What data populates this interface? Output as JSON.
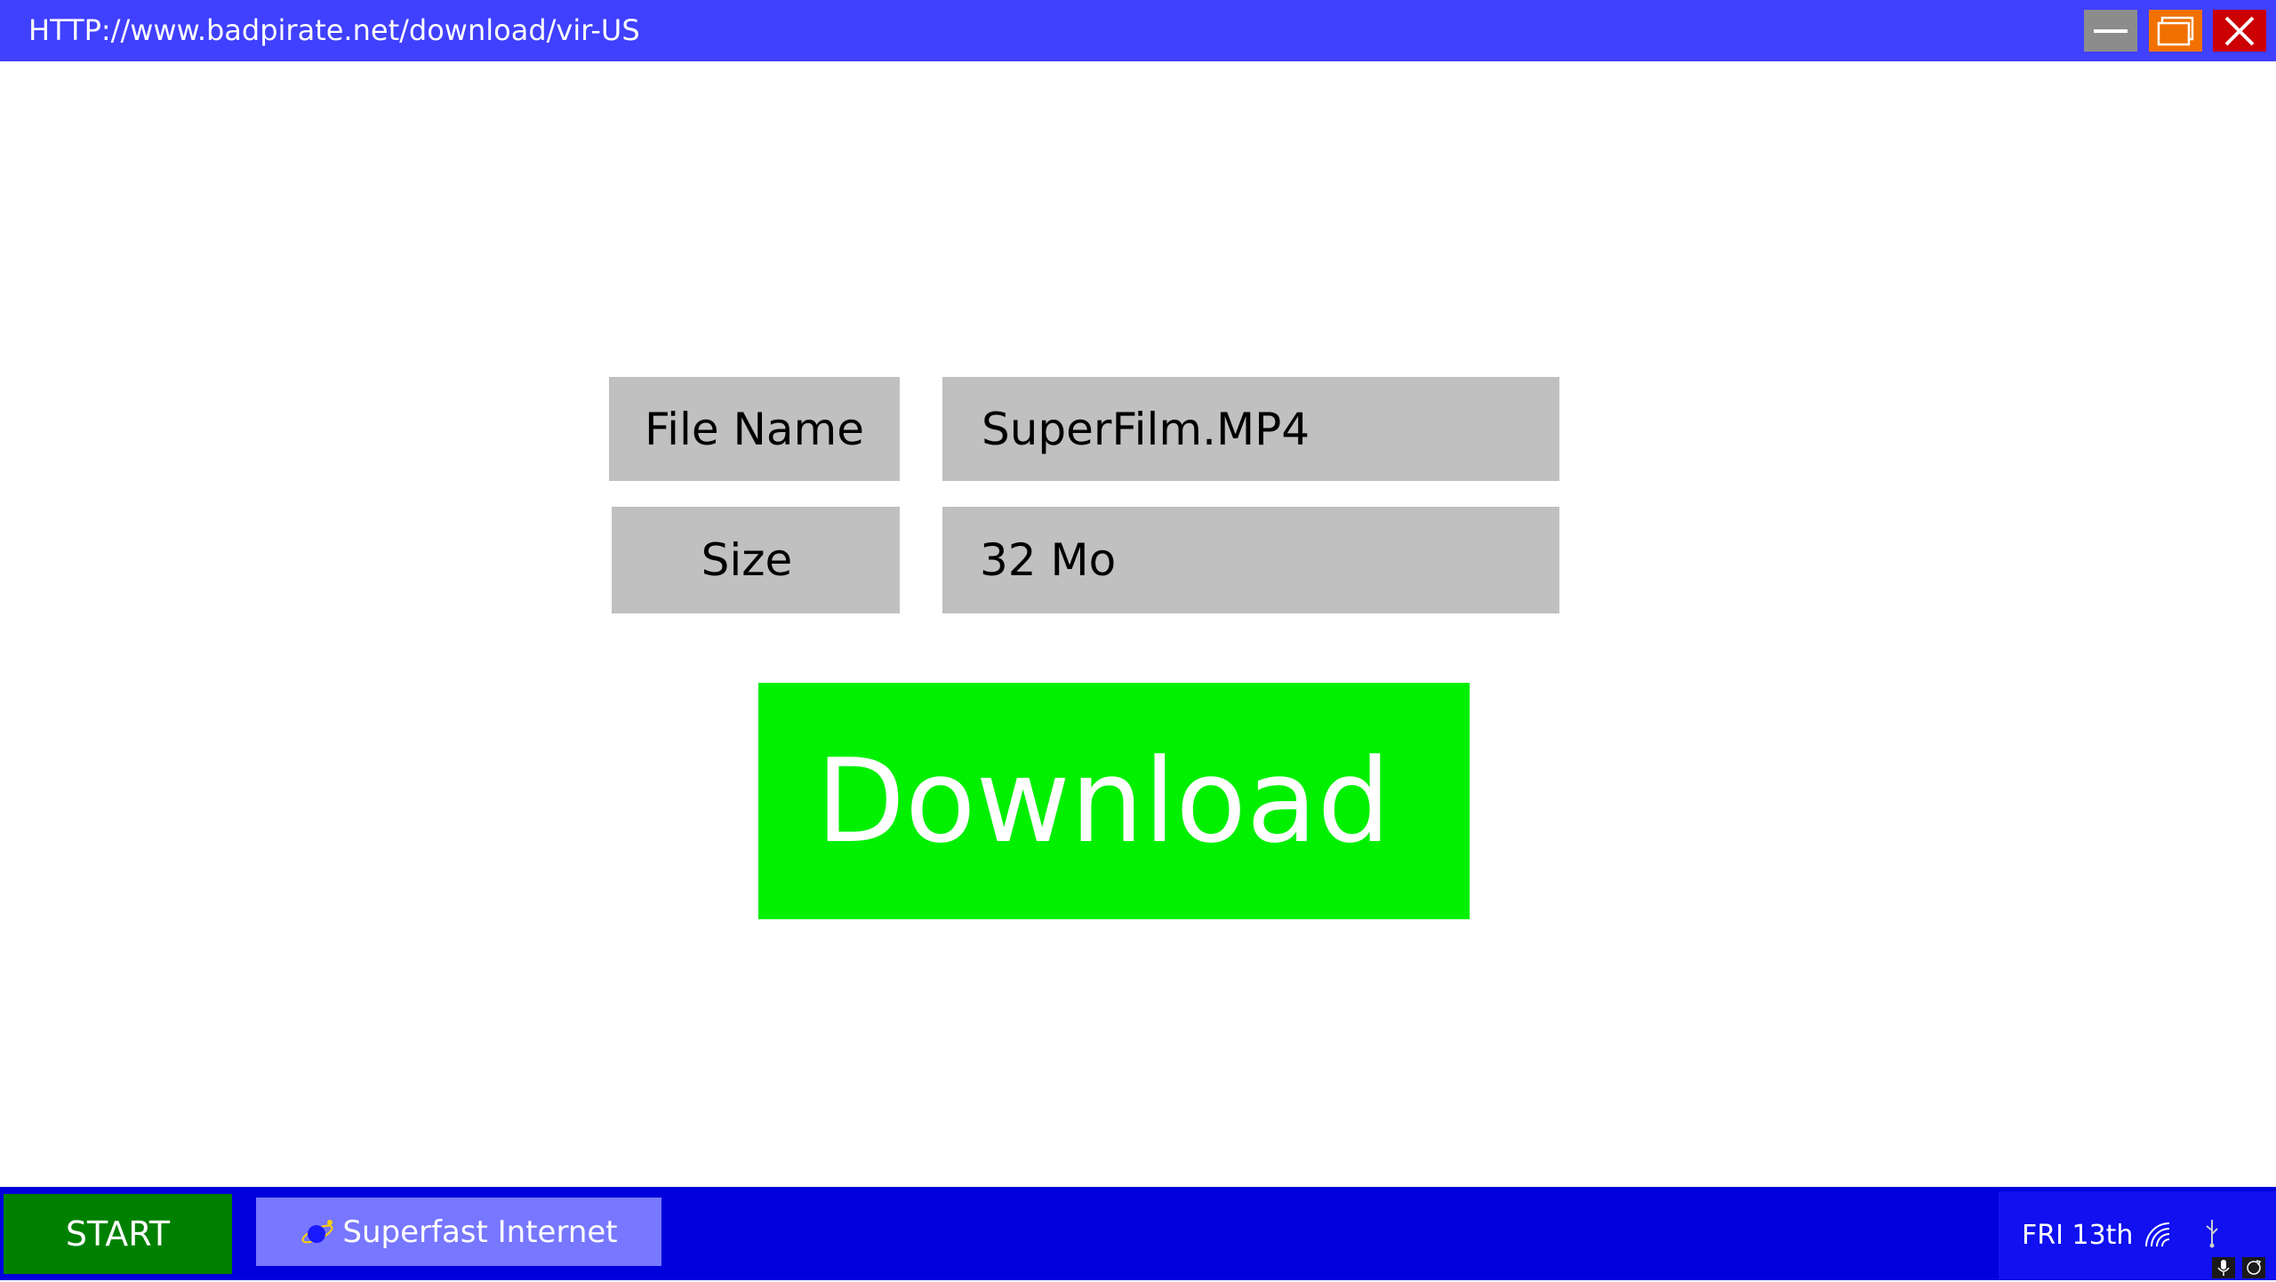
{
  "window": {
    "url": "HTTP://www.badpirate.net/download/vir-US",
    "controls": {
      "minimize_icon": "minimize-icon",
      "maximize_icon": "maximize-icon",
      "close_icon": "close-icon"
    },
    "colors": {
      "titlebar": "#4040ff",
      "minimize": "#8c8c8c",
      "maximize": "#f07000",
      "close": "#cc0000"
    }
  },
  "file_info": {
    "filename_label": "File Name",
    "filename_value": "SuperFilm.MP4",
    "size_label": "Size",
    "size_value": "32 Mo"
  },
  "download_button": {
    "label": "Download",
    "color": "#00f000"
  },
  "taskbar": {
    "start_label": "START",
    "task_item_label": "Superfast Internet",
    "task_item_icon": "planet-icon",
    "date": "FRI 13th",
    "tray_icons": [
      "wifi-icon",
      "usb-icon",
      "microphone-icon",
      "refresh-icon"
    ],
    "colors": {
      "bar": "#0000dd",
      "start": "#008000",
      "task_item": "#7777ff"
    }
  }
}
